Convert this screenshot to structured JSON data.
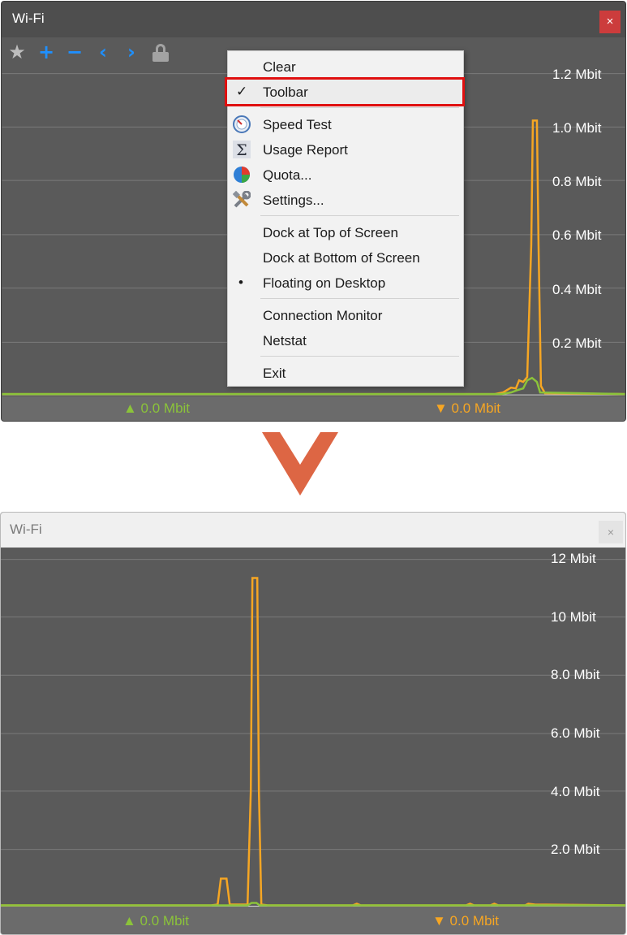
{
  "top_window": {
    "title": "Wi-Fi",
    "close_glyph": "×",
    "toolbar": {
      "icons": [
        "star-icon",
        "plus-icon",
        "minus-icon",
        "chevron-left-icon",
        "chevron-right-icon",
        "lock-icon"
      ]
    },
    "y_labels": [
      "1.2 Mbit",
      "1.0 Mbit",
      "0.8 Mbit",
      "0.6 Mbit",
      "0.4 Mbit",
      "0.2 Mbit"
    ],
    "upload_label": "▲ 0.0 Mbit",
    "download_label": "▼ 0.0 Mbit",
    "context_menu": {
      "items": [
        {
          "label": "Clear"
        },
        {
          "label": "Toolbar",
          "checked": true,
          "highlighted": true
        },
        {
          "label": "Speed Test",
          "icon": "speedometer-icon"
        },
        {
          "label": "Usage Report",
          "icon": "sigma-icon"
        },
        {
          "label": "Quota...",
          "icon": "pie-chart-icon"
        },
        {
          "label": "Settings...",
          "icon": "tools-icon"
        },
        {
          "label": "Dock at Top of Screen"
        },
        {
          "label": "Dock at Bottom of Screen"
        },
        {
          "label": "Floating on Desktop",
          "selected": true
        },
        {
          "label": "Connection Monitor"
        },
        {
          "label": "Netstat"
        },
        {
          "label": "Exit"
        }
      ],
      "check_glyph": "✓",
      "bullet_glyph": "•"
    }
  },
  "bottom_window": {
    "title": "Wi-Fi",
    "close_glyph": "×",
    "y_labels": [
      "12 Mbit",
      "10 Mbit",
      "8.0 Mbit",
      "6.0 Mbit",
      "4.0 Mbit",
      "2.0 Mbit"
    ],
    "upload_label": "▲ 0.0 Mbit",
    "download_label": "▼ 0.0 Mbit"
  },
  "colors": {
    "upload": "#8bc33a",
    "download": "#f6a623",
    "highlight_border": "#e01010",
    "arrow": "#dd6644"
  }
}
